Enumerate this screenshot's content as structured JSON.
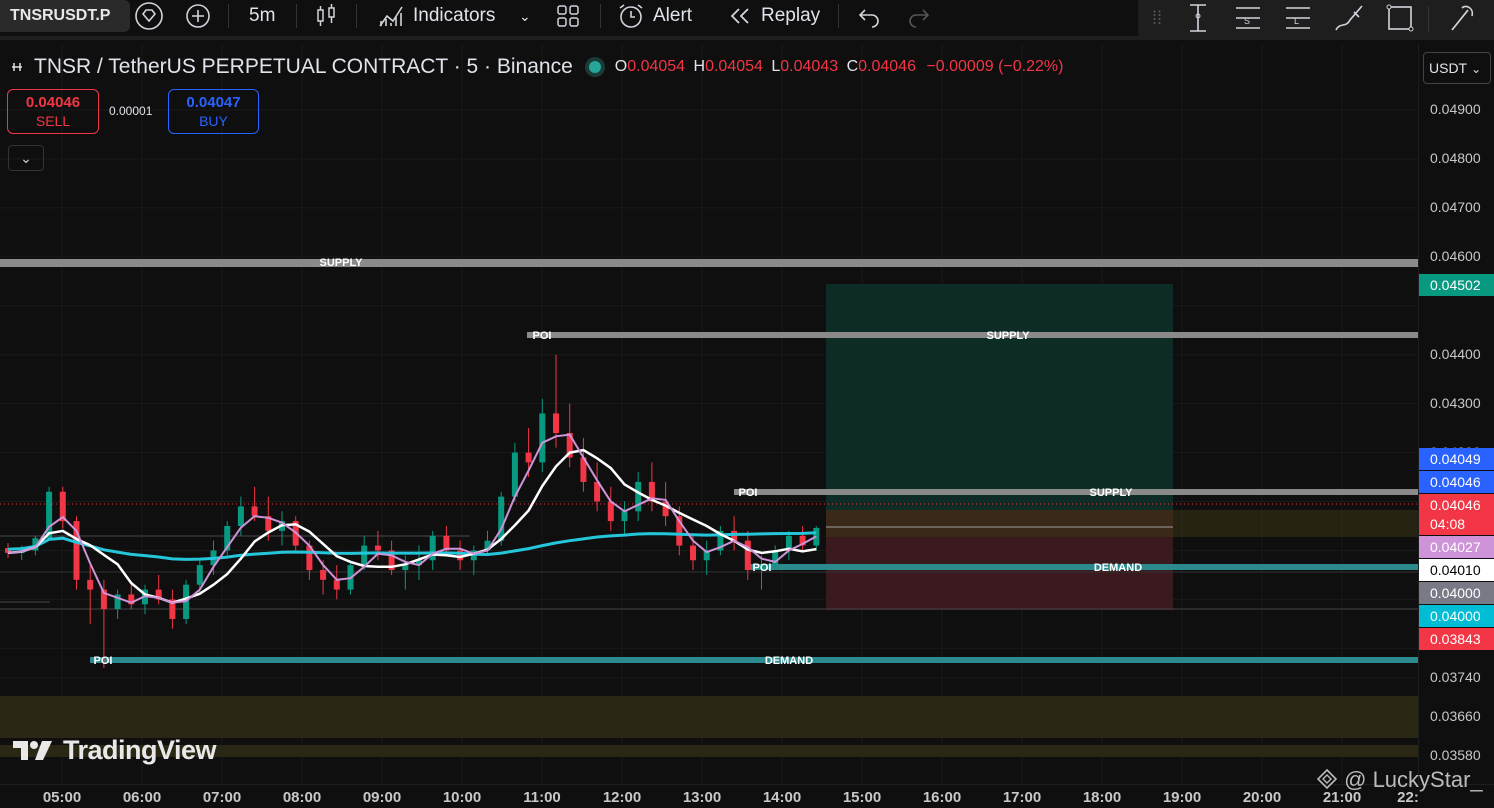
{
  "toolbar": {
    "symbol": "TNSRUSDT.P",
    "interval": "5m",
    "indicators_label": "Indicators",
    "alert_label": "Alert",
    "replay_label": "Replay"
  },
  "legend": {
    "title": "TNSR / TetherUS PERPETUAL CONTRACT · 5 · Binance",
    "o_key": "O",
    "o_val": "0.04054",
    "h_key": "H",
    "h_val": "0.04054",
    "l_key": "L",
    "l_val": "0.04043",
    "c_key": "C",
    "c_val": "0.04046",
    "change": "−0.00009 (−0.22%)"
  },
  "trade": {
    "sell_price": "0.04046",
    "sell_label": "SELL",
    "spread": "0.00001",
    "buy_price": "0.04047",
    "buy_label": "BUY"
  },
  "currency": "USDT",
  "price_axis": [
    "0.04900",
    "0.04800",
    "0.04700",
    "0.04600",
    "0.04400",
    "0.04300",
    "0.04200",
    "0.03740",
    "0.03660",
    "0.03580"
  ],
  "price_tags": [
    {
      "text": "0.04502",
      "color": "#089981"
    },
    {
      "text": "0.04049",
      "color": "#2962ff"
    },
    {
      "text": "0.04046",
      "color": "#2962ff"
    },
    {
      "text": "0.04046",
      "color": "#f23645"
    },
    {
      "text": "04:08",
      "color": "#f23645"
    },
    {
      "text": "0.04027",
      "color": "#ce93d8"
    },
    {
      "text": "0.04010",
      "color": "#ffffff"
    },
    {
      "text": "0.04000",
      "color": "#787b86"
    },
    {
      "text": "0.04000",
      "color": "#00bcd4"
    },
    {
      "text": "0.03843",
      "color": "#f23645"
    }
  ],
  "time_axis": [
    "05:00",
    "06:00",
    "07:00",
    "08:00",
    "09:00",
    "10:00",
    "11:00",
    "12:00",
    "13:00",
    "14:00",
    "15:00",
    "16:00",
    "17:00",
    "18:00",
    "19:00",
    "20:00",
    "21:00",
    "22:"
  ],
  "zones": {
    "supply_top": "SUPPLY",
    "poi_1": "POI",
    "supply_1": "SUPPLY",
    "poi_2": "POI",
    "supply_2": "SUPPLY",
    "poi_3": "POI",
    "demand_1": "DEMAND",
    "poi_4": "POI",
    "demand_2": "DEMAND"
  },
  "branding": {
    "logo": "TradingView",
    "watermark": "@ LuckyStar_"
  },
  "chart_data": {
    "type": "candlestick",
    "ylim": [
      0.0355,
      0.0498
    ],
    "candles": [
      [
        0.04005,
        0.04015,
        0.03985,
        0.03995
      ],
      [
        0.03995,
        0.0401,
        0.0398,
        0.04
      ],
      [
        0.04,
        0.0403,
        0.0399,
        0.04025
      ],
      [
        0.04025,
        0.0413,
        0.0402,
        0.0412
      ],
      [
        0.0412,
        0.0413,
        0.04045,
        0.0406
      ],
      [
        0.0406,
        0.0407,
        0.0392,
        0.0394
      ],
      [
        0.0394,
        0.0397,
        0.0385,
        0.0392
      ],
      [
        0.0392,
        0.0394,
        0.0376,
        0.0388
      ],
      [
        0.0388,
        0.0392,
        0.0386,
        0.0391
      ],
      [
        0.0391,
        0.0393,
        0.0388,
        0.0389
      ],
      [
        0.0389,
        0.0393,
        0.0387,
        0.0392
      ],
      [
        0.0392,
        0.0395,
        0.0389,
        0.039
      ],
      [
        0.039,
        0.0392,
        0.0384,
        0.0386
      ],
      [
        0.0386,
        0.0394,
        0.0385,
        0.0393
      ],
      [
        0.0393,
        0.0398,
        0.0391,
        0.0397
      ],
      [
        0.0397,
        0.0402,
        0.0395,
        0.04
      ],
      [
        0.04,
        0.0406,
        0.0399,
        0.0405
      ],
      [
        0.0405,
        0.0411,
        0.0403,
        0.0409
      ],
      [
        0.0409,
        0.0413,
        0.0406,
        0.0407
      ],
      [
        0.0407,
        0.0411,
        0.0402,
        0.0404
      ],
      [
        0.0404,
        0.0408,
        0.0401,
        0.0406
      ],
      [
        0.0406,
        0.0407,
        0.04,
        0.0401
      ],
      [
        0.0401,
        0.0402,
        0.0394,
        0.0396
      ],
      [
        0.0396,
        0.0398,
        0.0391,
        0.0394
      ],
      [
        0.0394,
        0.0397,
        0.039,
        0.0392
      ],
      [
        0.0392,
        0.0398,
        0.0391,
        0.0397
      ],
      [
        0.0397,
        0.0403,
        0.0396,
        0.0401
      ],
      [
        0.0401,
        0.0404,
        0.0398,
        0.04
      ],
      [
        0.04,
        0.0402,
        0.0395,
        0.0396
      ],
      [
        0.0396,
        0.0399,
        0.0392,
        0.0397
      ],
      [
        0.0397,
        0.0401,
        0.0394,
        0.0398
      ],
      [
        0.0398,
        0.0404,
        0.0396,
        0.0403
      ],
      [
        0.0403,
        0.0405,
        0.0399,
        0.04
      ],
      [
        0.04,
        0.0402,
        0.0396,
        0.0398
      ],
      [
        0.0398,
        0.0401,
        0.0395,
        0.04
      ],
      [
        0.04,
        0.0404,
        0.0399,
        0.0402
      ],
      [
        0.0402,
        0.0412,
        0.0401,
        0.0411
      ],
      [
        0.0411,
        0.0422,
        0.041,
        0.042
      ],
      [
        0.042,
        0.0425,
        0.0415,
        0.0418
      ],
      [
        0.0418,
        0.0431,
        0.0416,
        0.0428
      ],
      [
        0.0428,
        0.044,
        0.0421,
        0.0424
      ],
      [
        0.0424,
        0.043,
        0.0417,
        0.0419
      ],
      [
        0.0419,
        0.0423,
        0.0412,
        0.0414
      ],
      [
        0.0414,
        0.0418,
        0.0408,
        0.041
      ],
      [
        0.041,
        0.0413,
        0.0404,
        0.0406
      ],
      [
        0.0406,
        0.041,
        0.0403,
        0.0408
      ],
      [
        0.0408,
        0.0416,
        0.0406,
        0.0414
      ],
      [
        0.0414,
        0.0418,
        0.0408,
        0.041
      ],
      [
        0.041,
        0.0414,
        0.0405,
        0.0407
      ],
      [
        0.0407,
        0.0409,
        0.0399,
        0.0401
      ],
      [
        0.0401,
        0.0403,
        0.0396,
        0.0398
      ],
      [
        0.0398,
        0.0402,
        0.0395,
        0.04
      ],
      [
        0.04,
        0.0405,
        0.0399,
        0.0404
      ],
      [
        0.0404,
        0.0407,
        0.04,
        0.0402
      ],
      [
        0.0402,
        0.0404,
        0.0394,
        0.0396
      ],
      [
        0.0396,
        0.0399,
        0.0392,
        0.0397
      ],
      [
        0.0397,
        0.0401,
        0.0396,
        0.04
      ],
      [
        0.04,
        0.0404,
        0.0398,
        0.0403
      ],
      [
        0.0403,
        0.0405,
        0.04,
        0.0401
      ],
      [
        0.0401,
        0.0405,
        0.04,
        0.04046
      ]
    ]
  }
}
